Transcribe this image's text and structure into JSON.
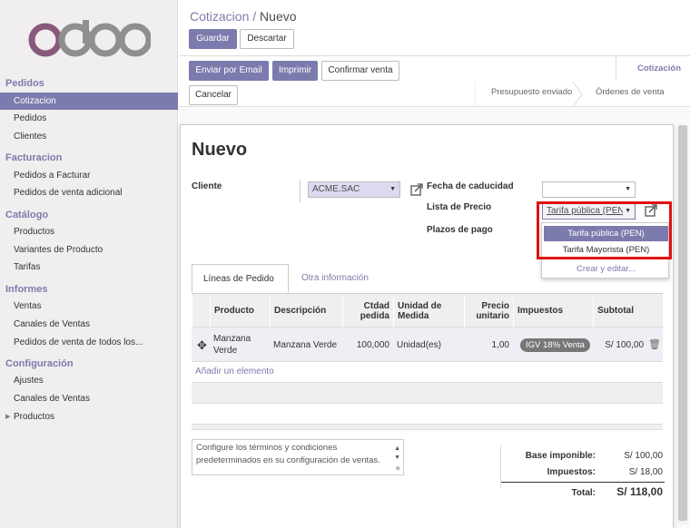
{
  "sidebar": {
    "sections": [
      {
        "title": "Pedidos",
        "items": [
          "Cotizacion",
          "Pedidos",
          "Clientes"
        ]
      },
      {
        "title": "Facturacion",
        "items": [
          "Pedidos a Facturar",
          "Pedidos de venta adicional"
        ]
      },
      {
        "title": "Catálogo",
        "items": [
          "Productos",
          "Variantes de Producto",
          "Tarifas"
        ]
      },
      {
        "title": "Informes",
        "items": [
          "Ventas",
          "Canales de Ventas",
          "Pedidos de venta de todos los..."
        ]
      },
      {
        "title": "Configuración",
        "items": [
          "Ajustes",
          "Canales de Ventas",
          "Productos"
        ]
      }
    ],
    "active_item": "Cotizacion"
  },
  "breadcrumb": {
    "parent": "Cotizacion",
    "separator": "/",
    "current": "Nuevo"
  },
  "control_buttons": {
    "save": "Guardar",
    "discard": "Descartar"
  },
  "statusbar": {
    "buttons": [
      "Enviar por Email",
      "Imprimir",
      "Confirmar venta",
      "Cancelar"
    ],
    "stages": [
      "Presupuesto enviado",
      "Órdenes de venta"
    ],
    "smart_button": "Cotización"
  },
  "form": {
    "title": "Nuevo",
    "cliente_label": "Cliente",
    "cliente_value": "ACME.SAC",
    "fecha_label": "Fecha de caducidad",
    "fecha_value": "",
    "lista_label": "Lista de Precio",
    "lista_value": "Tarifa pública (PEN)",
    "plazos_label": "Plazos de pago"
  },
  "dropdown": {
    "options": [
      "Tarifa pública (PEN)",
      "Tarifa Mayorista (PEN)"
    ],
    "highlighted_index": 0,
    "create_edit": "Crear y editar..."
  },
  "tabs": [
    "Líneas de Pedido",
    "Otra información"
  ],
  "lines_table": {
    "columns": [
      "Producto",
      "Descripción",
      "Ctdad pedida",
      "Unidad de Medida",
      "Precio unitario",
      "Impuestos",
      "Subtotal"
    ],
    "rows": [
      {
        "producto": "Manzana Verde",
        "descripcion": "Manzana Verde",
        "cantidad": "100,000",
        "unidad": "Unidad(es)",
        "precio": "1,00",
        "impuesto": "IGV 18% Venta",
        "subtotal": "S/ 100,00"
      }
    ],
    "add_line": "Añadir un elemento"
  },
  "notes": "Configure los términos y condiciones predeterminados en su configuración de ventas.",
  "totals": {
    "base_label": "Base imponible:",
    "base_value": "S/ 100,00",
    "tax_label": "Impuestos:",
    "tax_value": "S/ 18,00",
    "total_label": "Total:",
    "total_value": "S/ 118,00"
  },
  "colors": {
    "brand": "#7c7bad",
    "highlight_border": "#e01010",
    "logo_grey": "#8f8f8f",
    "logo_purple": "#875a7b"
  }
}
